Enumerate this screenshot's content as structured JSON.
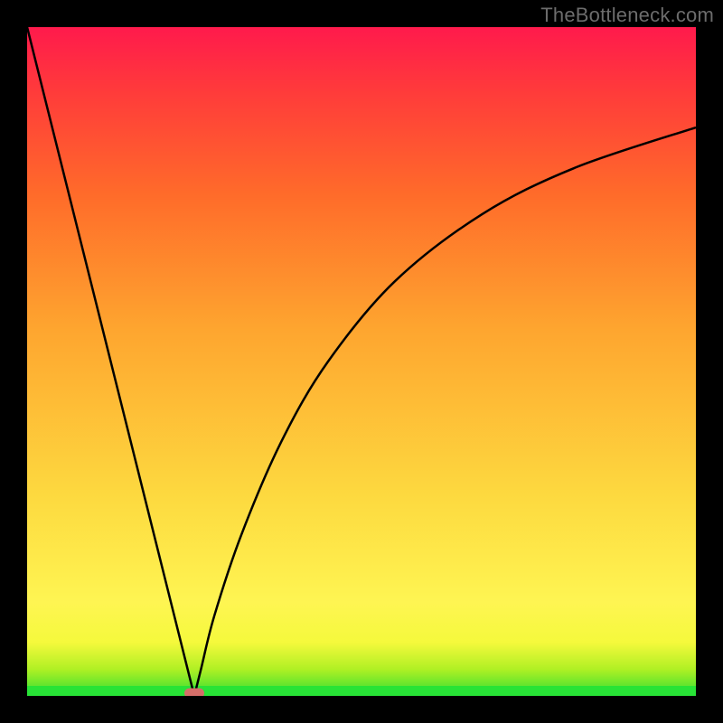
{
  "watermark": "TheBottleneck.com",
  "chart_data": {
    "type": "line",
    "title": "",
    "xlabel": "",
    "ylabel": "",
    "xlim": [
      0,
      100
    ],
    "ylim": [
      0,
      100
    ],
    "curve": {
      "minimum_x": 25,
      "points": [
        {
          "x": 0,
          "y": 100
        },
        {
          "x": 6,
          "y": 76
        },
        {
          "x": 12,
          "y": 52
        },
        {
          "x": 18,
          "y": 28
        },
        {
          "x": 24,
          "y": 4
        },
        {
          "x": 25,
          "y": 0
        },
        {
          "x": 26,
          "y": 4
        },
        {
          "x": 28,
          "y": 12
        },
        {
          "x": 32,
          "y": 24
        },
        {
          "x": 38,
          "y": 38
        },
        {
          "x": 45,
          "y": 50
        },
        {
          "x": 55,
          "y": 62
        },
        {
          "x": 68,
          "y": 72
        },
        {
          "x": 82,
          "y": 79
        },
        {
          "x": 100,
          "y": 85
        }
      ]
    },
    "marker": {
      "x": 25,
      "y": 0
    },
    "gradient_stops": [
      {
        "pct": 0,
        "color": "#28e336"
      },
      {
        "pct": 4,
        "color": "#b0f024"
      },
      {
        "pct": 14,
        "color": "#fef552"
      },
      {
        "pct": 55,
        "color": "#fea52f"
      },
      {
        "pct": 90,
        "color": "#ff3c3a"
      },
      {
        "pct": 100,
        "color": "#ff1a4c"
      }
    ]
  },
  "colors": {
    "background": "#000000",
    "curve": "#000000",
    "marker": "#d56e69",
    "watermark": "#6c6c6c"
  }
}
